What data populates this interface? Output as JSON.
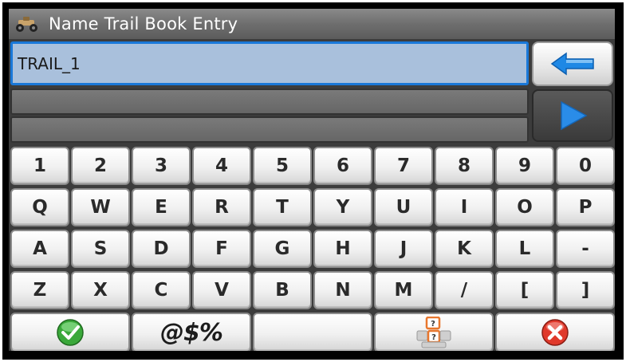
{
  "window": {
    "title": "Name Trail Book Entry",
    "icon": "atv-icon"
  },
  "entry": {
    "value": "TRAIL_1"
  },
  "buttons": {
    "backspace_icon": "arrow-left-icon",
    "next_icon": "play-right-icon"
  },
  "keyboard": {
    "rows": [
      [
        "1",
        "2",
        "3",
        "4",
        "5",
        "6",
        "7",
        "8",
        "9",
        "0"
      ],
      [
        "Q",
        "W",
        "E",
        "R",
        "T",
        "Y",
        "U",
        "I",
        "O",
        "P"
      ],
      [
        "A",
        "S",
        "D",
        "F",
        "G",
        "H",
        "J",
        "K",
        "L",
        "-"
      ],
      [
        "Z",
        "X",
        "C",
        "V",
        "B",
        "N",
        "M",
        "/",
        "[",
        "]"
      ]
    ],
    "actions": {
      "ok_icon": "check-icon",
      "symbols_label": "@$%",
      "space_label": "",
      "layout_icon": "keyboard-layout-icon",
      "cancel_icon": "close-icon"
    }
  },
  "colors": {
    "entry_bg": "#a9c0dc",
    "entry_border": "#1a78d8",
    "accent_blue": "#1e88e5",
    "ok_green": "#3aa83a",
    "cancel_red": "#e0392b",
    "layout_orange": "#e8772e"
  }
}
